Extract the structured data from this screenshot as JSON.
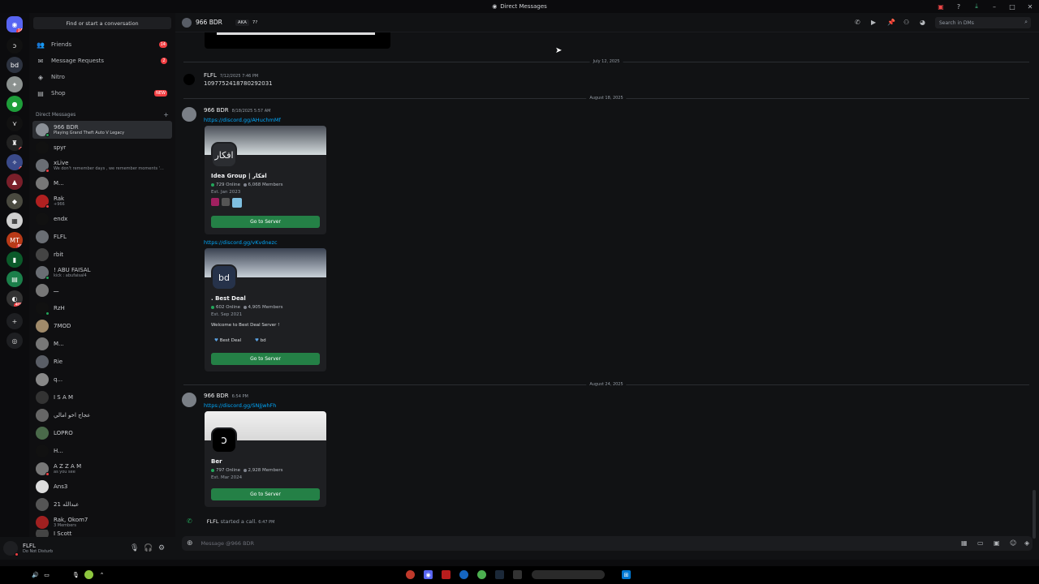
{
  "window": {
    "title": "Direct Messages"
  },
  "sidebar": {
    "search_placeholder": "Find or start a conversation",
    "nav": [
      {
        "label": "Friends",
        "count": "14"
      },
      {
        "label": "Message Requests",
        "count": "2"
      },
      {
        "label": "Nitro",
        "count": ""
      },
      {
        "label": "Shop",
        "count": "NEW"
      }
    ],
    "dm_header": "Direct Messages",
    "dms": [
      {
        "name": "966 BDR",
        "sub": "Playing Grand Theft Auto V Legacy"
      },
      {
        "name": "spyr",
        "sub": ""
      },
      {
        "name": "xLive",
        "sub": "We don't remember days , we remember moments '..."
      },
      {
        "name": "M...",
        "sub": ""
      },
      {
        "name": "Rak",
        "sub": "+966"
      },
      {
        "name": "endx",
        "sub": ""
      },
      {
        "name": "FLFL",
        "sub": ""
      },
      {
        "name": "rbit",
        "sub": ""
      },
      {
        "name": "! ABU FAISAL",
        "sub": "kick : abufaisal4"
      },
      {
        "name": "ـــ",
        "sub": ""
      },
      {
        "name": "RzH",
        "sub": ""
      },
      {
        "name": "7MOD",
        "sub": ""
      },
      {
        "name": "M...",
        "sub": ""
      },
      {
        "name": "Rie",
        "sub": ""
      },
      {
        "name": "q...",
        "sub": ""
      },
      {
        "name": "I S A M",
        "sub": ""
      },
      {
        "name": "عجاج اخو امالي",
        "sub": ""
      },
      {
        "name": "LOPRO",
        "sub": ""
      },
      {
        "name": "H...",
        "sub": ""
      },
      {
        "name": "A Z Z A M",
        "sub": "as you see"
      },
      {
        "name": "Ans3",
        "sub": ""
      },
      {
        "name": "21 عبدالله",
        "sub": ""
      },
      {
        "name": "Rak, Okom7",
        "sub": "3 Members"
      },
      {
        "name": "I Scott",
        "sub": ""
      }
    ]
  },
  "user": {
    "name": "FLFL",
    "status": "Do Not Disturb"
  },
  "header": {
    "name": "966 BDR",
    "aka": "AKA",
    "aka_value": "7?",
    "search_placeholder": "Search in DMs"
  },
  "dividers": [
    "July 12, 2025",
    "August 18, 2025",
    "August 24, 2025"
  ],
  "messages": [
    {
      "user": "FLFL",
      "time": "7/12/2025 7:46 PM",
      "text": "1097752418780292031"
    },
    {
      "user": "966 BDR",
      "time": "8/18/2025 5:57 AM",
      "link1": "https://discord.gg/AHuchmMf",
      "link2": "https://discord.gg/vKvdnezc"
    },
    {
      "user": "966 BDR",
      "time": "6:54 PM",
      "link1": "https://discord.gg/SNJjwhFh"
    }
  ],
  "cards": [
    {
      "name": "Idea Group | افكار",
      "online": "729 Online",
      "members": "6,068 Members",
      "est": "Est. Jan 2023",
      "desc": "",
      "button": "Go to Server",
      "icon": "افكار"
    },
    {
      "name": ". Best Deal",
      "online": "602 Online",
      "members": "4,905 Members",
      "est": "Est. Sep 2021",
      "desc": "Welcome to Best Deal Server !",
      "tag1": "Best Deal",
      "tag2": "bd",
      "button": "Go to Server",
      "icon": "bd"
    },
    {
      "name": "Ber",
      "online": "797 Online",
      "members": "2,928 Members",
      "est": "Est. Mar 2024",
      "desc": "",
      "button": "Go to Server",
      "icon": "ↄ"
    }
  ],
  "call": {
    "user": "FLFL",
    "text": "started a call.",
    "time": "6:47 PM"
  },
  "composer": {
    "placeholder": "Message @966 BDR"
  },
  "colors": {
    "accent": "#5865f2",
    "online": "#23a55a",
    "button": "#248046",
    "link": "#00a8fc",
    "badge": "#f23f43"
  }
}
